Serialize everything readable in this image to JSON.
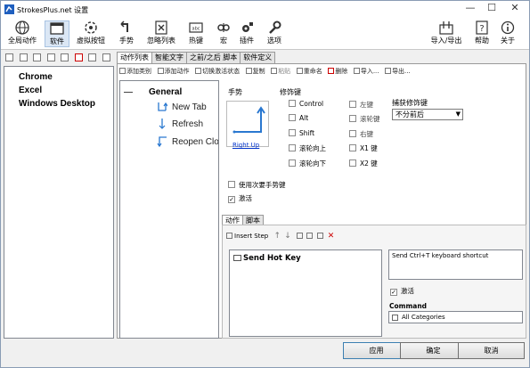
{
  "window": {
    "title": "StrokesPlus.net 设置",
    "controls": {
      "minimize": "—",
      "maximize": "☐",
      "close": "✕"
    }
  },
  "toolbar": {
    "items": [
      {
        "label": "全局动作",
        "icon": "globe-icon"
      },
      {
        "label": "软件",
        "icon": "window-icon"
      },
      {
        "label": "虚拟按钮",
        "icon": "crosshair-icon"
      },
      {
        "label": "手势",
        "icon": "gesture-arrow-icon"
      },
      {
        "label": "忽略列表",
        "icon": "ignore-list-icon"
      },
      {
        "label": "热键",
        "icon": "hotkey-icon"
      },
      {
        "label": "宏",
        "icon": "macro-icon"
      },
      {
        "label": "插件",
        "icon": "plugin-icon"
      },
      {
        "label": "选项",
        "icon": "wrench-icon"
      }
    ],
    "right_items": [
      {
        "label": "导入/导出",
        "icon": "import-export-icon"
      },
      {
        "label": "帮助",
        "icon": "help-icon"
      },
      {
        "label": "关于",
        "icon": "about-icon"
      }
    ],
    "active": "软件"
  },
  "apps": {
    "items": [
      "Chrome",
      "Excel",
      "Windows Desktop"
    ]
  },
  "tabs": {
    "items": [
      "动作列表",
      "智能文字",
      "之前/之后 脚本",
      "软件定义"
    ],
    "selected": "动作列表"
  },
  "action_toolbar": {
    "items": [
      "添加类别",
      "添加动作",
      "切换激活状态",
      "复制",
      "粘贴",
      "重命名",
      "删除",
      "导入...",
      "导出..."
    ]
  },
  "tree": {
    "group": "General",
    "nodes": [
      "New Tab",
      "Refresh",
      "Reopen Closed Tab"
    ]
  },
  "gesture": {
    "label": "手势",
    "name": "Right Up"
  },
  "modifiers": {
    "label": "修饰键",
    "col1": [
      "Control",
      "Alt",
      "Shift",
      "滚轮向上",
      "滚轮向下"
    ],
    "col2": [
      "左键",
      "滚轮键",
      "右键",
      "X1 键",
      "X2 键"
    ]
  },
  "capture": {
    "label": "捕获修饰键",
    "value": "不分前后"
  },
  "options": {
    "secondary": "使用次要手势键",
    "active": "激活"
  },
  "sub_tabs": {
    "items": [
      "动作",
      "脚本"
    ],
    "selected": "动作"
  },
  "step_toolbar": {
    "insert": "Insert Step"
  },
  "steps": {
    "items": [
      "Send Hot Key"
    ]
  },
  "step_detail": {
    "description": "Send Ctrl+T keyboard shortcut",
    "active": "激活",
    "command_label": "Command",
    "command_value": "All Categories"
  },
  "buttons": {
    "apply": "应用",
    "ok": "确定",
    "cancel": "取消"
  }
}
